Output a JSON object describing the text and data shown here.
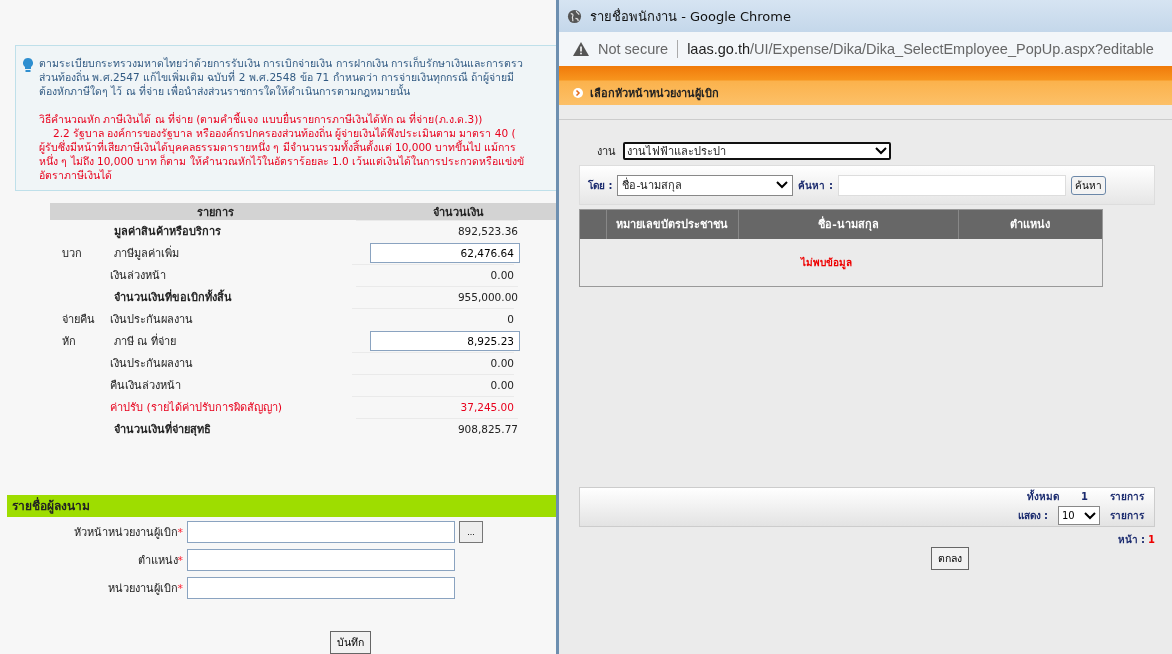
{
  "notice": {
    "lines": [
      "ตามระเบียบกระทรวงมหาดไทยว่าด้วยการรับเงิน การเบิกจ่ายเงิน การฝากเงิน การเก็บรักษาเงินและการตรว",
      "ส่วนท้องถิ่น พ.ศ.2547 แก้ไขเพิ่มเติม ฉบับที่ 2 พ.ศ.2548 ข้อ 71 กำหนดว่า การจ่ายเงินทุกกรณี ถ้าผู้จ่ายมี",
      "ต้องหักภาษีใดๆ ไว้ ณ ที่จ่าย เพื่อนำส่งส่วนราชการใดให้ดำเนินการตามกฎหมายนั้น"
    ],
    "warning_title": "วิธีคำนวณหัก ภาษีเงินได้ ณ ที่จ่าย (ตามคำชี้แจง แบบยื่นรายการภาษีเงินได้หัก ณ ที่จ่าย(ภ.ง.ด.3))",
    "warning_lines": [
      "2.2 รัฐบาล องค์การของรัฐบาล หรือองค์กรปกครองส่วนท้องถิ่น ผู้จ่ายเงินได้พึงประเมินตาม มาตรา 40 (",
      "ผู้รับซึ่งมีหน้าที่เสียภาษีเงินได้บุคคลธรรมดารายหนึ่ง ๆ มีจำนวนรวมทั้งสิ้นตั้งแต่ 10,000 บาทขึ้นไป แม้การ",
      "หนึ่ง ๆ ไม่ถึง 10,000 บาท ก็ตาม ให้คำนวณหักไว้ในอัตราร้อยละ 1.0 เว้นแต่เงินได้ในการประกวดหรือแข่งขั",
      "อัตราภาษีเงินได้"
    ]
  },
  "summary": {
    "columns": [
      "รายการ",
      "จำนวนเงิน"
    ],
    "rows": [
      {
        "prefix": "",
        "label": "มูลค่าสินค้าหรือบริการ",
        "value": "892,523.36",
        "kind": "total"
      },
      {
        "prefix": "บวก",
        "label": "ภาษีมูลค่าเพิ่ม",
        "value": "62,476.64",
        "kind": "input"
      },
      {
        "prefix": "",
        "label": "เงินล่วงหน้า",
        "value": "0.00",
        "kind": "item"
      },
      {
        "prefix": "",
        "label": "จำนวนเงินที่ขอเบิกทั้งสิ้น",
        "value": "955,000.00",
        "kind": "total"
      },
      {
        "prefix": "จ่ายคืน",
        "label": "เงินประกันผลงาน",
        "value": "0",
        "kind": "item"
      },
      {
        "prefix": "หัก",
        "label": "ภาษี ณ ที่จ่าย",
        "value": "8,925.23",
        "kind": "input"
      },
      {
        "prefix": "",
        "label": "เงินประกันผลงาน",
        "value": "0.00",
        "kind": "item"
      },
      {
        "prefix": "",
        "label": "คืนเงินล่วงหน้า",
        "value": "0.00",
        "kind": "item"
      },
      {
        "prefix": "",
        "label": "ค่าปรับ (รายได้ค่าปรับการผิดสัญญา)",
        "value": "37,245.00",
        "kind": "penalty"
      },
      {
        "prefix": "",
        "label": "จำนวนเงินที่จ่ายสุทธิ",
        "value": "908,825.77",
        "kind": "total"
      }
    ]
  },
  "signers": {
    "title": "รายชื่อผู้ลงนาม",
    "fields": [
      {
        "label": "หัวหน้าหน่วยงานผู้เบิก",
        "required_mark": "*",
        "has_picker": true,
        "picker_label": "..."
      },
      {
        "label": "ตำแหน่ง",
        "required_mark": "*",
        "has_picker": false
      },
      {
        "label": "หน่วยงานผู้เบิก",
        "required_mark": "*",
        "has_picker": false
      }
    ],
    "save_button": "บันทึก"
  },
  "popup": {
    "window_title": "รายชื่อพนักงาน - Google Chrome",
    "security": "Not secure",
    "url_host": "laas.go.th",
    "url_path": "/UI/Expense/Dika/Dika_SelectEmployee_PopUp.aspx?editable",
    "header": "เลือกหัวหน้าหน่วยงานผู้เบิก",
    "department_label": "งาน",
    "department_value": "งานไฟฟ้าและประปา",
    "search_by_label": "โดย :",
    "search_by_value": "ชื่อ-นามสกุล",
    "search_label": "ค้นหา :",
    "search_button": "ค้นหา",
    "table": {
      "columns": [
        "หมายเลขบัตรประชาชน",
        "ชื่อ-นามสกุล",
        "ตำแหน่ง"
      ],
      "empty_message": "ไม่พบข้อมูล"
    },
    "footer": {
      "total_label": "ทั้งหมด",
      "total": "1",
      "total_unit": "รายการ",
      "show_label": "แสดง :",
      "show_value": "10",
      "show_unit": "รายการ",
      "page_label": "หน้า :",
      "page": "1"
    },
    "ok_button": "ตกลง"
  }
}
